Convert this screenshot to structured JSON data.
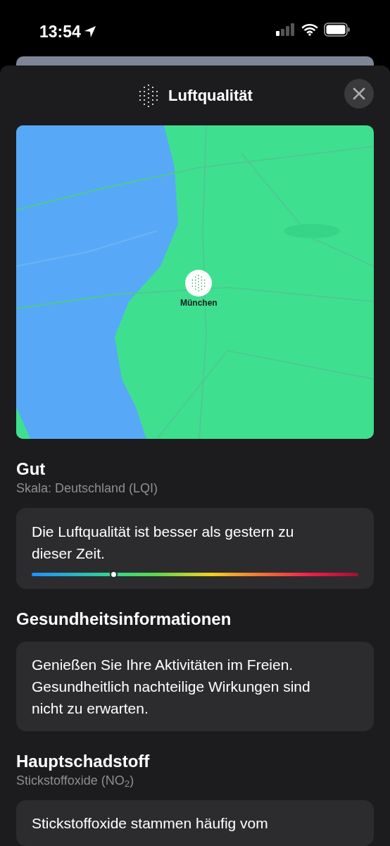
{
  "status_bar": {
    "time": "13:54"
  },
  "sheet": {
    "title": "Luftqualität"
  },
  "map": {
    "kind": "picture",
    "pin_label": "München"
  },
  "rating": {
    "title": "Gut",
    "scale": "Skala: Deutschland (LQI)"
  },
  "comparison": {
    "text": "Die Luftqualität ist besser als gestern zu dieser Zeit.",
    "level": 0.25
  },
  "sections": [
    {
      "title": "Gesundheitsinformationen",
      "text": "Genießen Sie Ihre Aktivitäten im Freien. Gesundheitlich nachteilige Wirkungen sind nicht zu erwarten."
    },
    {
      "title": "Hauptschadstoff",
      "subtitle": "Stickstoffoxide (NO$_{2}$)",
      "text": "Stickstoffoxide stammen häufig vom"
    }
  ]
}
